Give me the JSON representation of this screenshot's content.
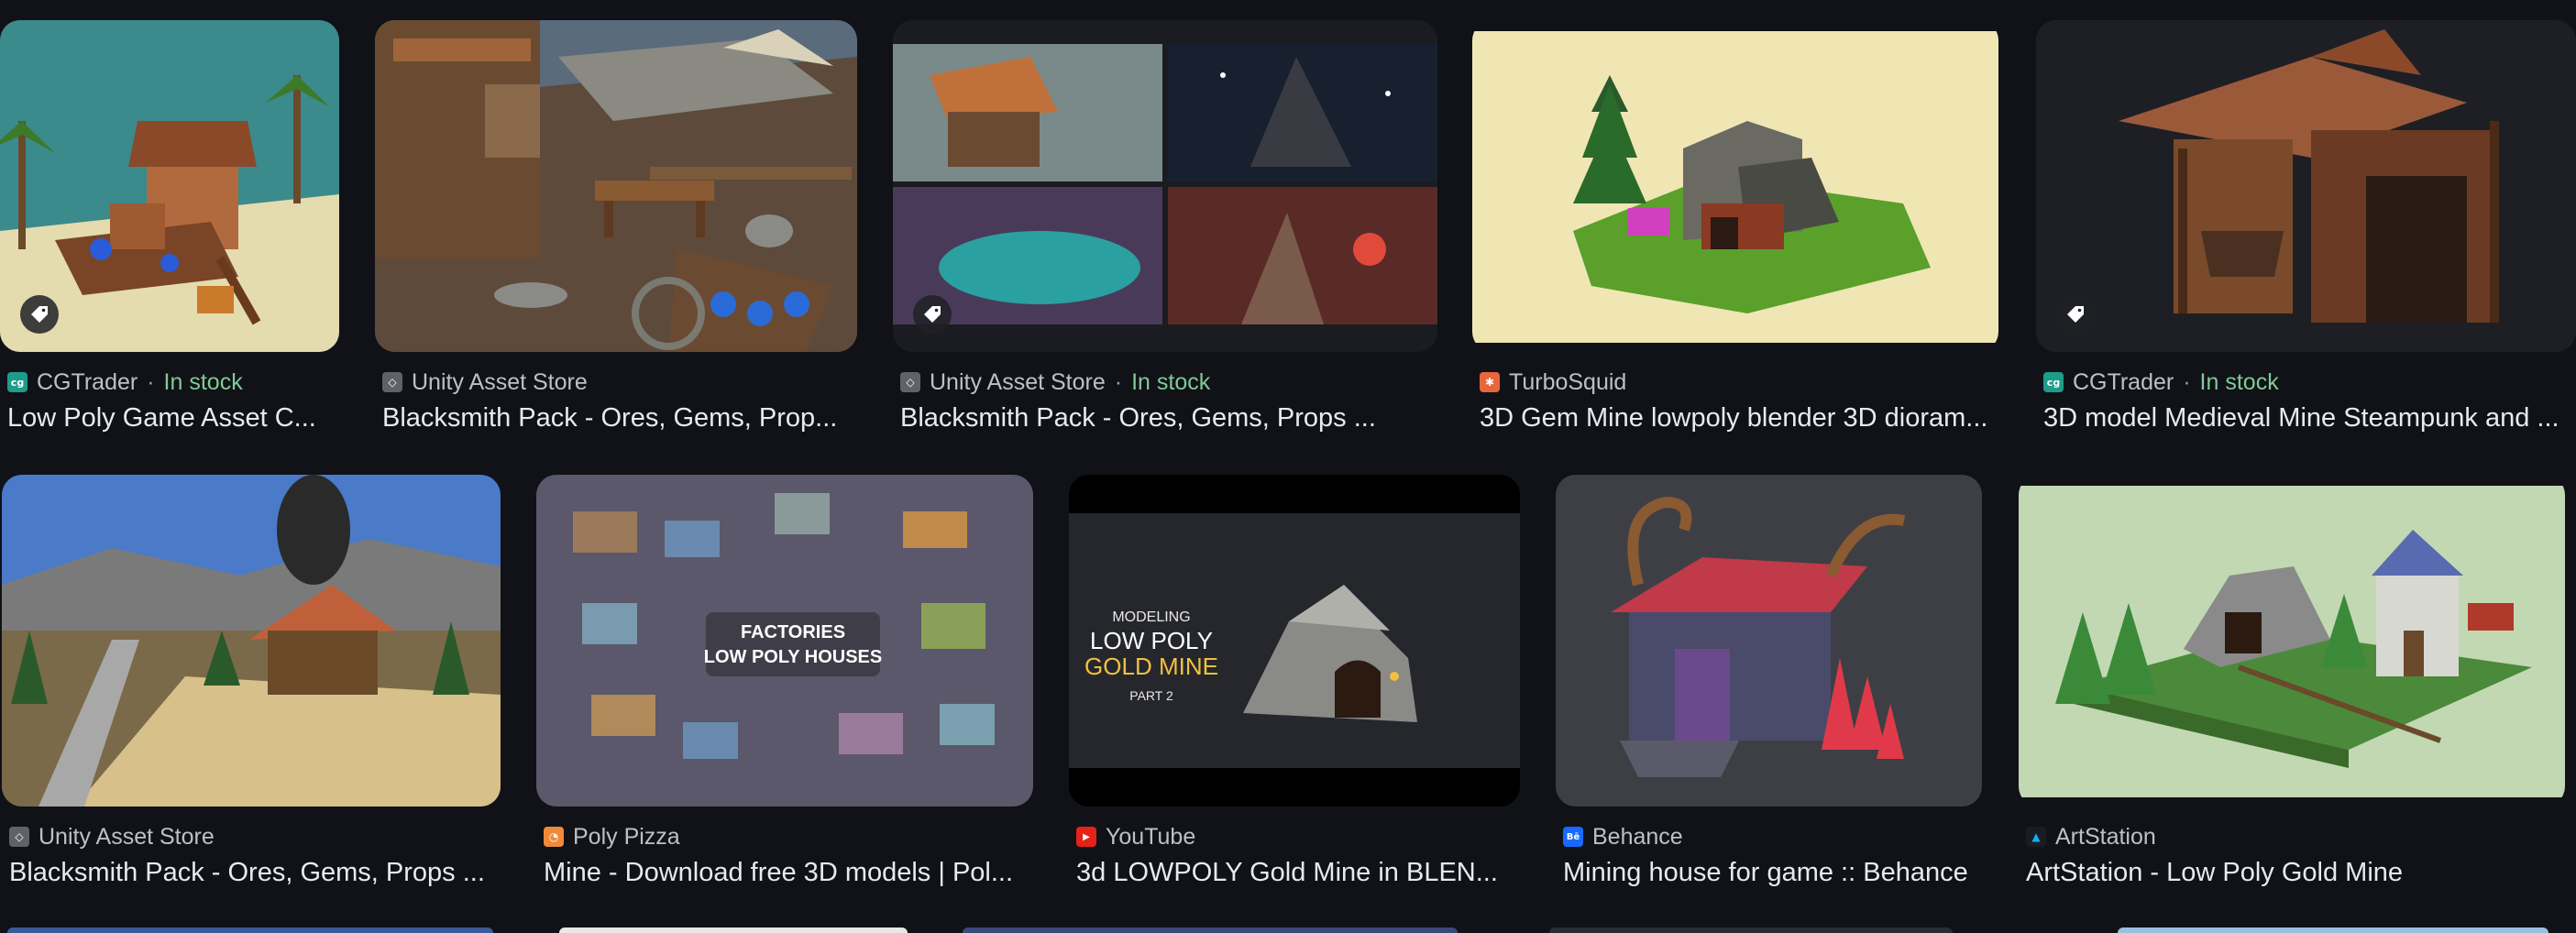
{
  "results": [
    {
      "source": "CGTrader",
      "stock": "In stock",
      "title": "Low Poly Game Asset C...",
      "favicon": "cgtrader-icon",
      "tag": true
    },
    {
      "source": "Unity Asset Store",
      "stock": "",
      "title": "Blacksmith Pack - Ores, Gems, Prop...",
      "favicon": "unity-icon",
      "tag": false
    },
    {
      "source": "Unity Asset Store",
      "stock": "In stock",
      "title": "Blacksmith Pack - Ores, Gems, Props ...",
      "favicon": "unity-icon",
      "tag": true
    },
    {
      "source": "TurboSquid",
      "stock": "",
      "title": "3D Gem Mine lowpoly blender 3D dioram...",
      "favicon": "turbosquid-icon",
      "tag": false
    },
    {
      "source": "CGTrader",
      "stock": "In stock",
      "title": "3D model Medieval Mine Steampunk and ...",
      "favicon": "cgtrader-icon",
      "tag": true
    },
    {
      "source": "Unity Asset Store",
      "stock": "",
      "title": "Blacksmith Pack - Ores, Gems, Props ...",
      "favicon": "unity-icon",
      "tag": false
    },
    {
      "source": "Poly Pizza",
      "stock": "",
      "title": "Mine - Download free 3D models | Pol...",
      "favicon": "polypizza-icon",
      "tag": false
    },
    {
      "source": "YouTube",
      "stock": "",
      "title": "3d LOWPOLY Gold Mine in BLEN...",
      "favicon": "youtube-icon",
      "tag": false
    },
    {
      "source": "Behance",
      "stock": "",
      "title": "Mining house for game :: Behance",
      "favicon": "behance-icon",
      "tag": false
    },
    {
      "source": "ArtStation",
      "stock": "",
      "title": "ArtStation - Low Poly Gold Mine",
      "favicon": "artstation-icon",
      "tag": false
    }
  ],
  "thumb_text": {
    "factories_line1": "FACTORIES",
    "factories_line2": "LOW POLY HOUSES",
    "yt_line1": "MODELING",
    "yt_line2": "LOW POLY",
    "yt_line3": "GOLD MINE",
    "yt_line4": "PART 2"
  },
  "favicon_glyphs": {
    "cgtrader": "cg",
    "turbosquid": "✱",
    "unity": "◇",
    "polypizza": "◔",
    "youtube": "▶",
    "behance": "Bē",
    "artstation": "▲"
  },
  "colors": {
    "background": "#101218",
    "title": "#e8eaed",
    "source": "#bdc1c6",
    "in_stock": "#81c995"
  }
}
